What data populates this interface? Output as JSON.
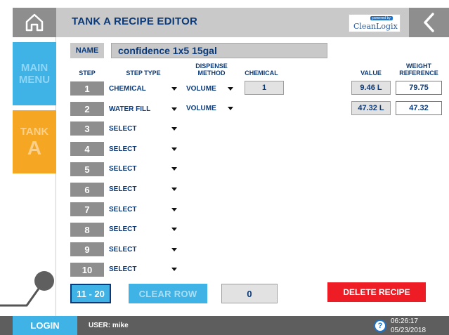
{
  "header": {
    "title": "TANK A RECIPE EDITOR",
    "logo_top": "powered by",
    "logo_text": "CleanLogix"
  },
  "nav": {
    "main_menu_line1": "MAIN",
    "main_menu_line2": "MENU",
    "tank_label": "TANK",
    "tank_letter": "A"
  },
  "recipe": {
    "name_label": "NAME",
    "name_value": "confidence 1x5 15gal"
  },
  "columns": {
    "step": "STEP",
    "step_type": "STEP TYPE",
    "dispense_line1": "DISPENSE",
    "dispense_line2": "METHOD",
    "chemical": "CHEMICAL",
    "value": "VALUE",
    "weight_line1": "WEIGHT",
    "weight_line2": "REFERENCE"
  },
  "steps": [
    {
      "num": "1",
      "type": "CHEMICAL",
      "method": "VOLUME",
      "chemical": "1",
      "value": "9.46 L",
      "weight": "79.75"
    },
    {
      "num": "2",
      "type": "WATER FILL",
      "method": "VOLUME",
      "value": "47.32 L",
      "weight": "47.32"
    },
    {
      "num": "3",
      "type": "SELECT"
    },
    {
      "num": "4",
      "type": "SELECT"
    },
    {
      "num": "5",
      "type": "SELECT"
    },
    {
      "num": "6",
      "type": "SELECT"
    },
    {
      "num": "7",
      "type": "SELECT"
    },
    {
      "num": "8",
      "type": "SELECT"
    },
    {
      "num": "9",
      "type": "SELECT"
    },
    {
      "num": "10",
      "type": "SELECT"
    }
  ],
  "bottom": {
    "range_button": "11 - 20",
    "clear_row": "CLEAR ROW",
    "counter": "0",
    "delete_recipe": "DELETE RECIPE"
  },
  "footer": {
    "login": "LOGIN",
    "user": "USER: mike",
    "help": "?",
    "time": "06:26:17",
    "date": "05/23/2018"
  },
  "colors": {
    "accent_blue": "#3fb2e6",
    "tank_orange": "#f5a623",
    "delete_red": "#ee1c25",
    "text_navy": "#0b3a7a"
  }
}
